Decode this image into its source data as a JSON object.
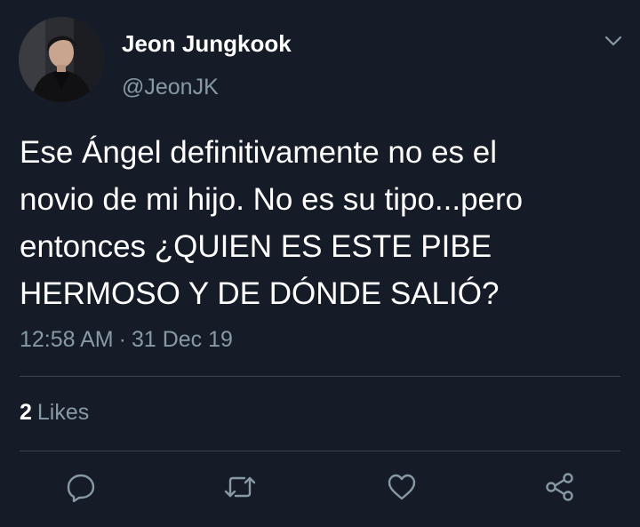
{
  "user": {
    "display_name": "Jeon Jungkook",
    "handle": "@JeonJK"
  },
  "tweet": {
    "text_lines": [
      "Ese Ángel definitivamente no es el",
      "novio de mi hijo. No es su tipo...pero",
      "entonces ¿QUIEN ES ESTE PIBE",
      "HERMOSO Y DE DÓNDE SALIÓ?"
    ],
    "time": "12:58 AM",
    "separator": "·",
    "date": "31 Dec 19"
  },
  "stats": {
    "likes_count": "2",
    "likes_label": "Likes"
  },
  "icons": {
    "menu": "chevron-down-icon",
    "reply": "reply-icon",
    "retweet": "retweet-icon",
    "like": "heart-icon",
    "share": "share-icon"
  },
  "colors": {
    "background": "#151c27",
    "text_primary": "#ffffff",
    "text_secondary": "#8899a6",
    "divider": "#38444d"
  }
}
